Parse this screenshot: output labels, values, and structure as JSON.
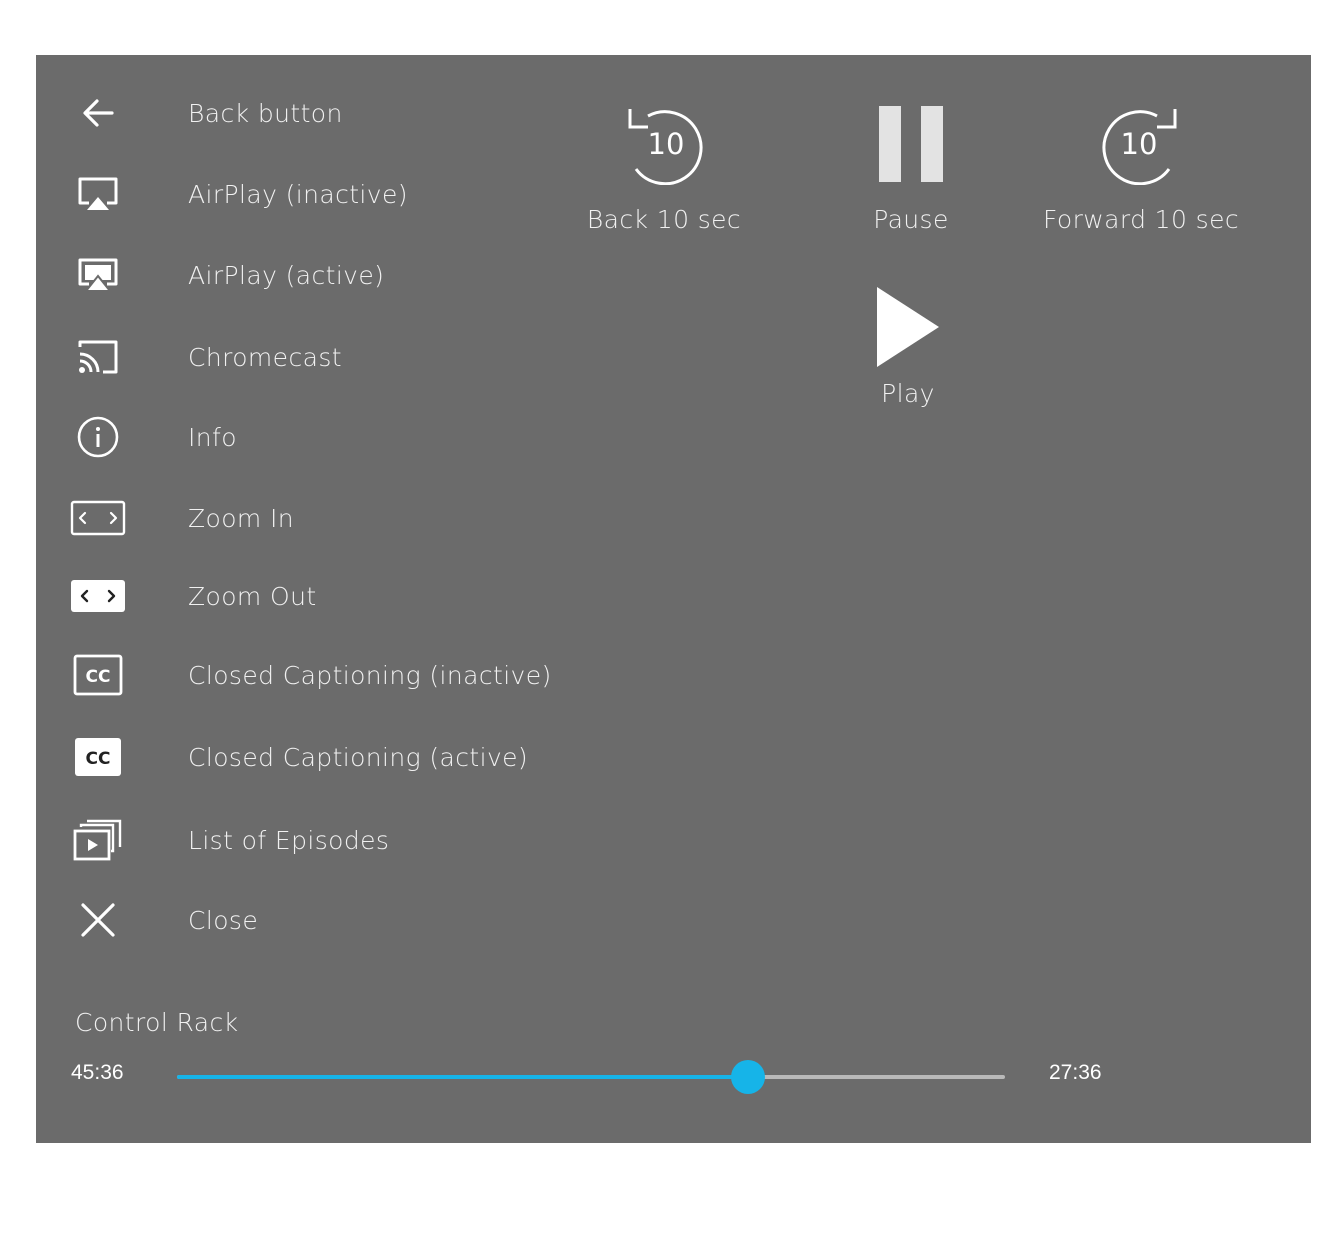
{
  "legend": {
    "items": [
      {
        "icon": "arrow-left-icon",
        "label": "Back button"
      },
      {
        "icon": "airplay-inactive-icon",
        "label": "AirPlay (inactive)"
      },
      {
        "icon": "airplay-active-icon",
        "label": "AirPlay (active)"
      },
      {
        "icon": "chromecast-icon",
        "label": "Chromecast"
      },
      {
        "icon": "info-icon",
        "label": "Info"
      },
      {
        "icon": "zoom-in-icon",
        "label": "Zoom In"
      },
      {
        "icon": "zoom-out-icon",
        "label": "Zoom Out"
      },
      {
        "icon": "closed-captioning-inactive-icon",
        "label": "Closed Captioning (inactive)"
      },
      {
        "icon": "closed-captioning-active-icon",
        "label": "Closed Captioning (active)"
      },
      {
        "icon": "episode-list-icon",
        "label": "List of Episodes"
      },
      {
        "icon": "close-icon",
        "label": "Close"
      }
    ]
  },
  "controls": {
    "back10": {
      "icon": "rewind-10-icon",
      "label": "Back 10 sec",
      "seconds": "10"
    },
    "pause": {
      "icon": "pause-icon",
      "label": "Pause"
    },
    "forward10": {
      "icon": "forward-10-icon",
      "label": "Forward 10 sec",
      "seconds": "10"
    },
    "play": {
      "icon": "play-icon",
      "label": "Play"
    }
  },
  "control_rack": {
    "title": "Control Rack",
    "elapsed": "45:36",
    "remaining": "27:36",
    "progress": 0.69
  },
  "colors": {
    "panel_bg": "#6b6b6b",
    "accent": "#16b4e8",
    "track": "#b9b9b9",
    "text": "#f1f1f1"
  }
}
